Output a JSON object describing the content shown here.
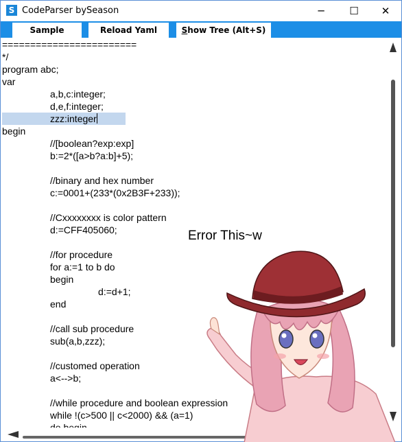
{
  "window": {
    "title": "CodeParser bySeason",
    "icon_letter": "S",
    "minimize_glyph": "─",
    "maximize_glyph": "☐",
    "close_glyph": "✕"
  },
  "toolbar": {
    "sample_label": "Sample",
    "reload_label": "Reload Yaml",
    "tree_label_prefix": "S",
    "tree_label_rest": "how Tree (Alt+S)"
  },
  "editor": {
    "lines": [
      "========================",
      "*/",
      "program abc;",
      "var",
      "                  a,b,c:integer;",
      "                  d,e,f:integer;",
      "                  zzz:integer",
      "begin",
      "                  //[boolean?exp:exp]",
      "                  b:=2*([a>b?a:b]+5);",
      "",
      "                  //binary and hex number",
      "                  c:=0001+(233*(0x2B3F+233));",
      "",
      "                  //Cxxxxxxxx is color pattern",
      "                  d:=CFF405060;",
      "",
      "                  //for procedure",
      "                  for a:=1 to b do",
      "                  begin",
      "                                    d:=d+1;",
      "                  end",
      "",
      "                  //call sub procedure",
      "                  sub(a,b,zzz);",
      "",
      "                  //customed operation",
      "                  a<-->b;",
      "",
      "                  //while procedure and boolean expression",
      "                  while !(c>500 || c<2000) && (a=1)",
      "                  do begin"
    ],
    "selected_line_index": 6
  },
  "overlay": {
    "error_text": "Error This~w"
  },
  "colors": {
    "toolbar_bg": "#1c8ee6",
    "selection": "#c3d7ee",
    "hat": "#8f2a2e",
    "hair": "#e9a3b4",
    "shirt": "#f7cdd1"
  },
  "icons": {
    "scroll_up": "triangle-up",
    "scroll_down": "triangle-down",
    "scroll_left": "triangle-left",
    "scroll_right": "triangle-right"
  }
}
